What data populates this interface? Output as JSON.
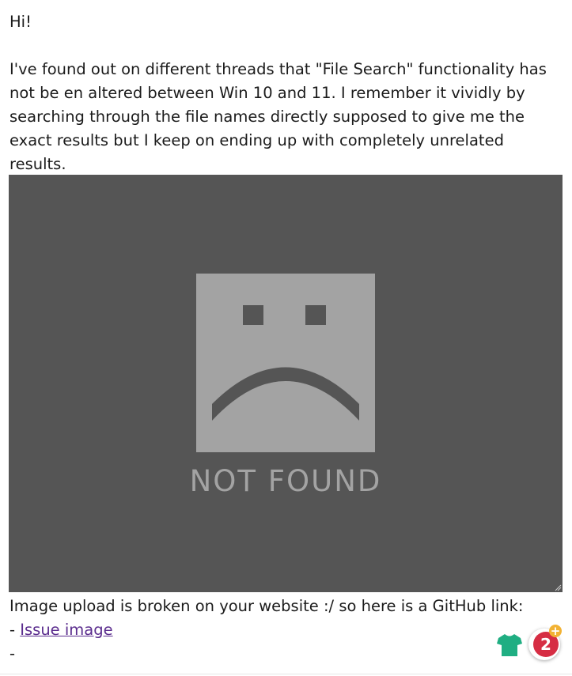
{
  "post": {
    "greeting": "Hi!",
    "body": "I've found out on different threads that \"File Search\" functionality has not be en altered between Win 10 and 11. I remember it vividly by searching through the file names directly supposed to give me the exact results but I keep on ending up with completely unrelated results.",
    "after_image_text": "Image upload is broken on your website :/ so here is a GitHub link:",
    "link_prefix": "- ",
    "link_text": "Issue image",
    "trailing_dash": "-"
  },
  "broken_image": {
    "label": "NOT FOUND",
    "background_color": "#555555",
    "icon_color": "#a3a3a3",
    "icon": "sad-face-icon"
  },
  "floating_widgets": {
    "shirt_icon": "tshirt-icon",
    "shirt_color": "#1fae82",
    "badge_count": "2",
    "badge_plus": "+",
    "badge_color": "#d62d43",
    "plus_color": "#f2b234"
  }
}
